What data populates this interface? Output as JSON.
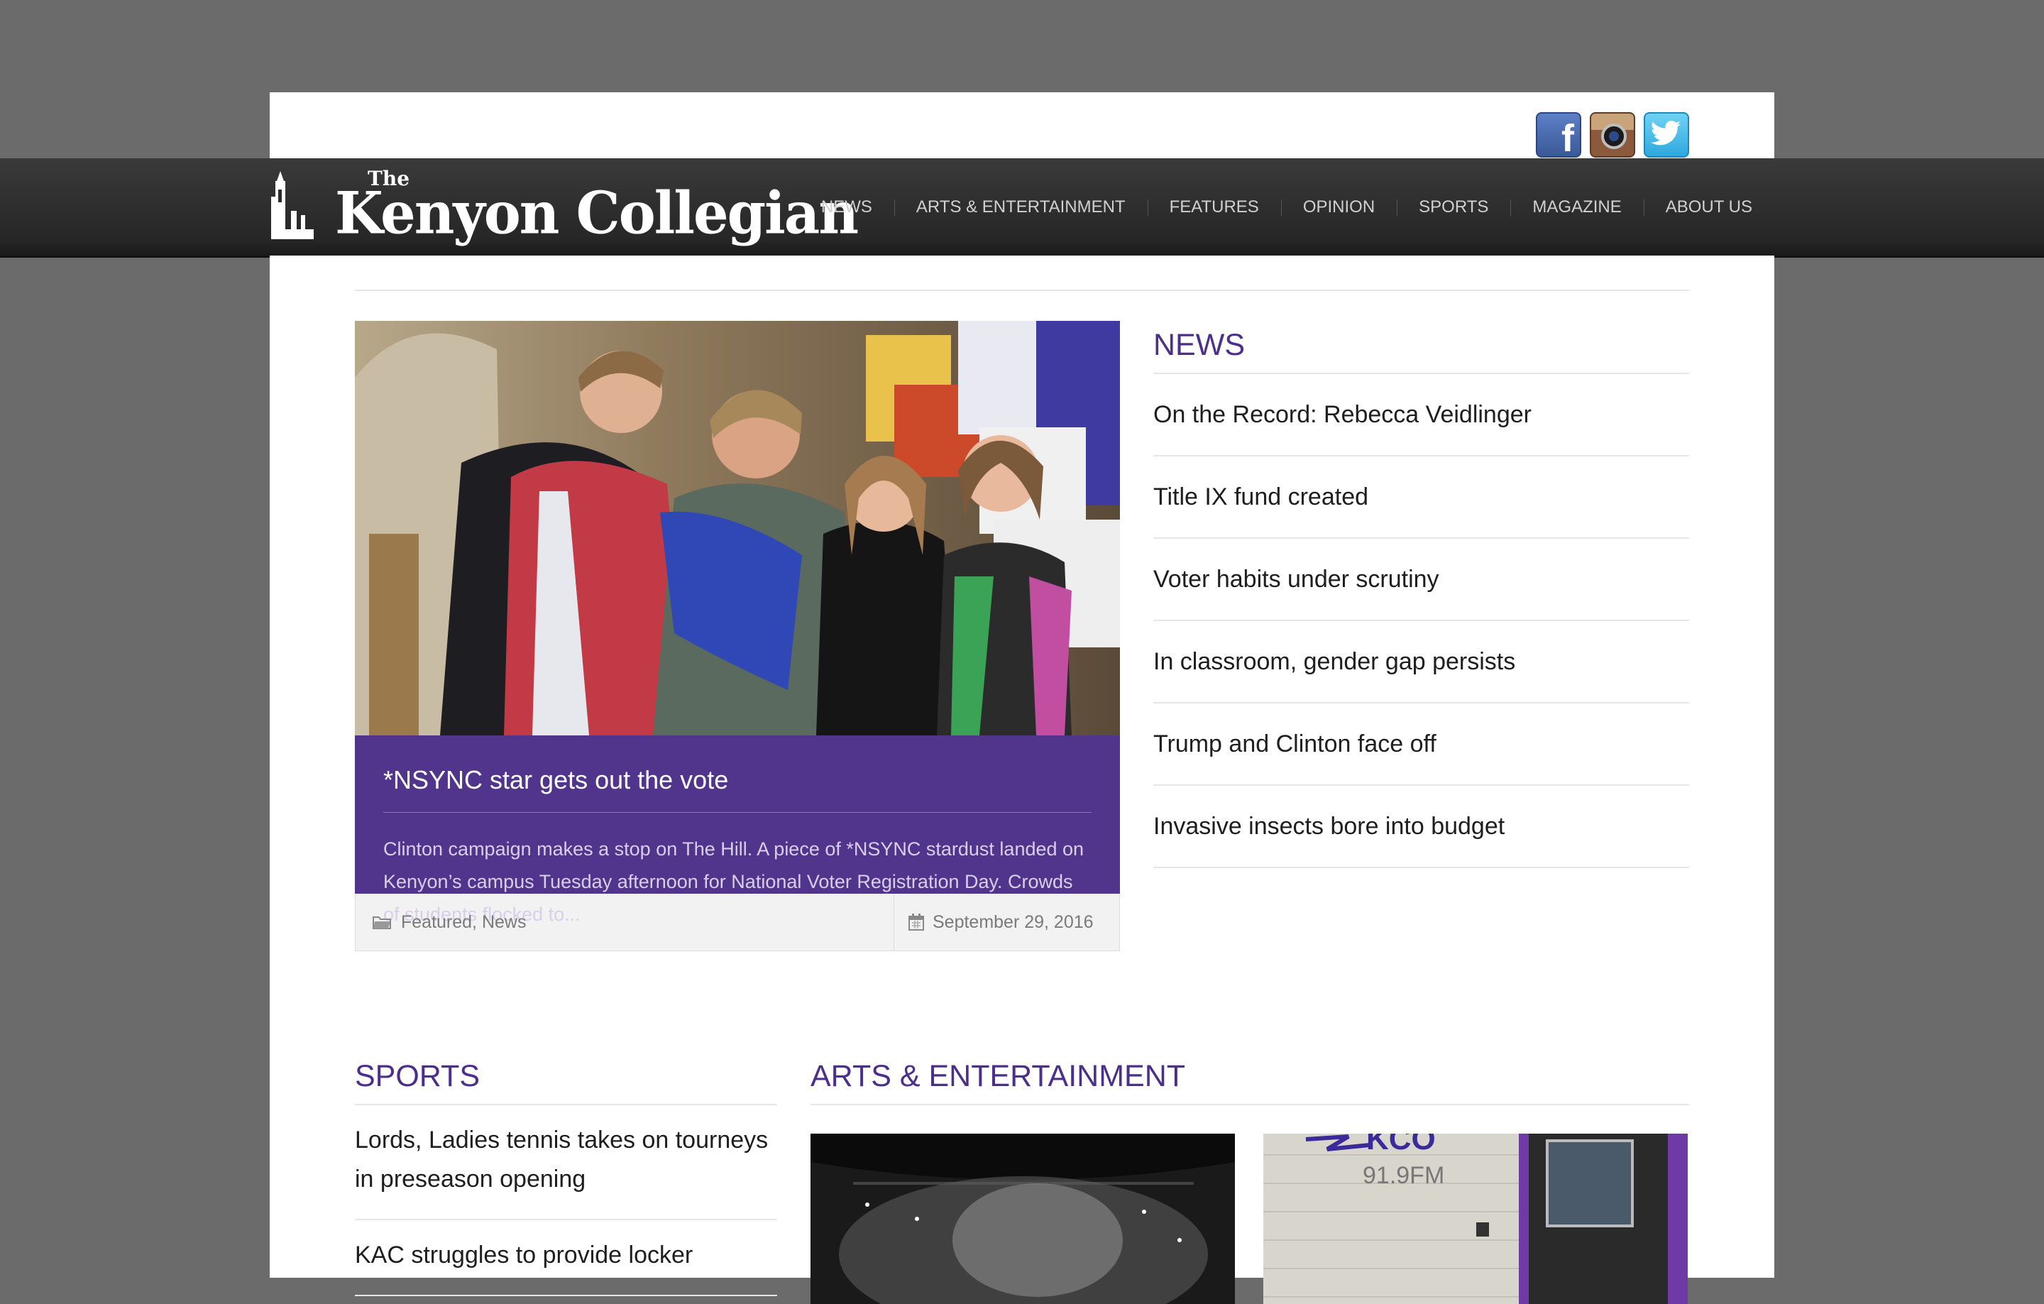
{
  "site": {
    "logo_the": "The",
    "logo_name": "Kenyon Collegian"
  },
  "social": [
    "facebook-icon",
    "instagram-icon",
    "twitter-icon"
  ],
  "nav": [
    "NEWS",
    "ARTS & ENTERTAINMENT",
    "FEATURES",
    "OPINION",
    "SPORTS",
    "MAGAZINE",
    "ABOUT US"
  ],
  "featured": {
    "title": "*NSYNC star gets out the vote",
    "excerpt": "Clinton campaign makes a stop on The Hill. A piece of *NSYNC stardust landed on Kenyon’s campus Tuesday afternoon for National Voter Registration Day. Crowds of students flocked to...",
    "categories": "Featured, News",
    "date": "September 29, 2016"
  },
  "news": {
    "heading": "NEWS",
    "items": [
      "On the Record: Rebecca Veidlinger",
      "Title IX fund created",
      "Voter habits under scrutiny",
      "In classroom, gender gap persists",
      "Trump and Clinton face off",
      "Invasive insects bore into budget"
    ]
  },
  "sports": {
    "heading": "SPORTS",
    "items": [
      "Lords, Ladies tennis takes on tourneys in preseason opening",
      "KAC struggles to provide locker"
    ]
  },
  "ae": {
    "heading": "ARTS & ENTERTAINMENT",
    "thumb2_sign": "KCO",
    "thumb2_sub": "91.9FM"
  },
  "colors": {
    "brand_purple": "#51358d",
    "heading_purple": "#4b2f8b",
    "nav_bg": "#2b2b2b",
    "outer_bg": "#6b6b6b"
  }
}
